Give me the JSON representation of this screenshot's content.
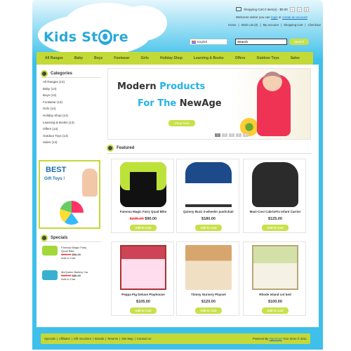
{
  "header": {
    "logo_text": "Kids St",
    "logo_o": "O",
    "logo_tail": "re",
    "cart_summary": "Shopping Cart 0 item(s) - $0.00",
    "cart_prev": "‹",
    "cart_next": "›",
    "cart_count": "1",
    "welcome_prefix": "Welcome visitor you can",
    "login_link": "login",
    "welcome_or": "or",
    "create_account_link": "create an account",
    "top_links": [
      "Home",
      "|",
      "Wish List (0)",
      "|",
      "My Account",
      "|",
      "Shopping Cart",
      "|",
      "Checkout"
    ],
    "language": "English",
    "search_value": "Search",
    "search_button": "Search"
  },
  "nav": {
    "items": [
      "All Ranges",
      "Baby",
      "Boys",
      "Footwear",
      "Girls",
      "Holiday Shop",
      "Learning & Books",
      "Offers",
      "Outdoor Toys",
      "Sales"
    ]
  },
  "sidebar": {
    "categories_title": "Categories",
    "categories": [
      "All Ranges (14)",
      "Baby (14)",
      "Boys (14)",
      "Footwear (14)",
      "Girls (14)",
      "Holiday Shop (14)",
      "Learning & Books (14)",
      "Offers (14)",
      "Outdoor Toys (14)",
      "Sales (14)"
    ],
    "banner_best": "BEST",
    "banner_gift": "Gift Toys !",
    "specials_title": "Specials",
    "specials": [
      {
        "name_line1": "Famosa Magic Fairy",
        "name_line2": "Quad Bike",
        "old_price": "$235.00",
        "new_price": "$90.00",
        "add": "Add to Cart"
      },
      {
        "name_line1": "McQueen Battery Car",
        "name_line2": "",
        "old_price": "$385.00",
        "new_price": "$80.00",
        "add": "Add to Cart"
      }
    ]
  },
  "hero": {
    "line1_a": "Modern ",
    "line1_b": "Products",
    "line2_a": "For The ",
    "line2_b": "NewAge",
    "shop_now": "Shop Now",
    "dots": [
      "1",
      "2",
      "3",
      "4",
      "5"
    ]
  },
  "featured": {
    "title": "Featured",
    "products": [
      {
        "name": "Famosa Magic Fairy Quad Bike",
        "old_price": "$235.00",
        "price": "$90.00",
        "add": "Add to Cart",
        "icon": "quad-bike-image"
      },
      {
        "name": "Quinny Buzz 3-wheeler pushchair",
        "old_price": "",
        "price": "$180.00",
        "add": "Add to Cart",
        "icon": "stroller-image"
      },
      {
        "name": "Maxi-Cosi CabrioFix Infant Carrier",
        "old_price": "",
        "price": "$125.00",
        "add": "Add to Cart",
        "icon": "car-seat-image"
      },
      {
        "name": "Peppa Pig Deluxe Playhouse",
        "old_price": "",
        "price": "$105.00",
        "add": "Add to Cart",
        "icon": "dollhouse-image"
      },
      {
        "name": "Timmy Nursery Playset",
        "old_price": "",
        "price": "$120.00",
        "add": "Add to Cart",
        "icon": "nursery-playset-image"
      },
      {
        "name": "Rhode Island cot bed",
        "old_price": "",
        "price": "$100.00",
        "add": "Add to Cart",
        "icon": "bunk-bed-image"
      }
    ]
  },
  "footer": {
    "links": [
      "Specials",
      "|",
      "Affiliates",
      "|",
      "Gift Vouchers",
      "|",
      "Brands",
      "|",
      "Returns",
      "|",
      "Site Map",
      "|",
      "Contact Us"
    ],
    "powered_prefix": "Powered By",
    "powered_link": "OpenCart",
    "powered_suffix": "Your Store © 2011"
  },
  "colors": {
    "accent_green": "#c3d938",
    "frame_blue": "#3ec0ea",
    "brand_blue": "#29a8d8"
  }
}
